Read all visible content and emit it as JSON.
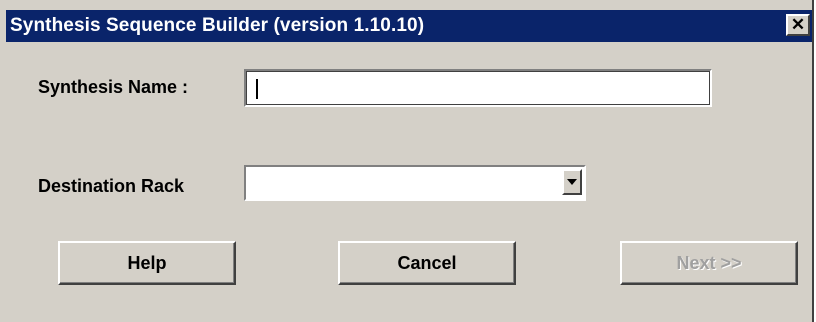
{
  "window": {
    "title": "Synthesis Sequence Builder (version 1.10.10)",
    "close_symbol": "✕"
  },
  "form": {
    "synthesis_name": {
      "label": "Synthesis Name :",
      "value": "",
      "placeholder": ""
    },
    "destination_rack": {
      "label": "Destination Rack",
      "selected_value": ""
    }
  },
  "buttons": {
    "help_label": "Help",
    "cancel_label": "Cancel",
    "next_label": "Next >>",
    "next_enabled": false
  },
  "icons": {
    "close": "close-icon",
    "dropdown": "chevron-down-icon"
  },
  "colors": {
    "titlebar": "#0a246a",
    "window_face": "#d4d0c8",
    "disabled_text": "#a0a0a0"
  }
}
